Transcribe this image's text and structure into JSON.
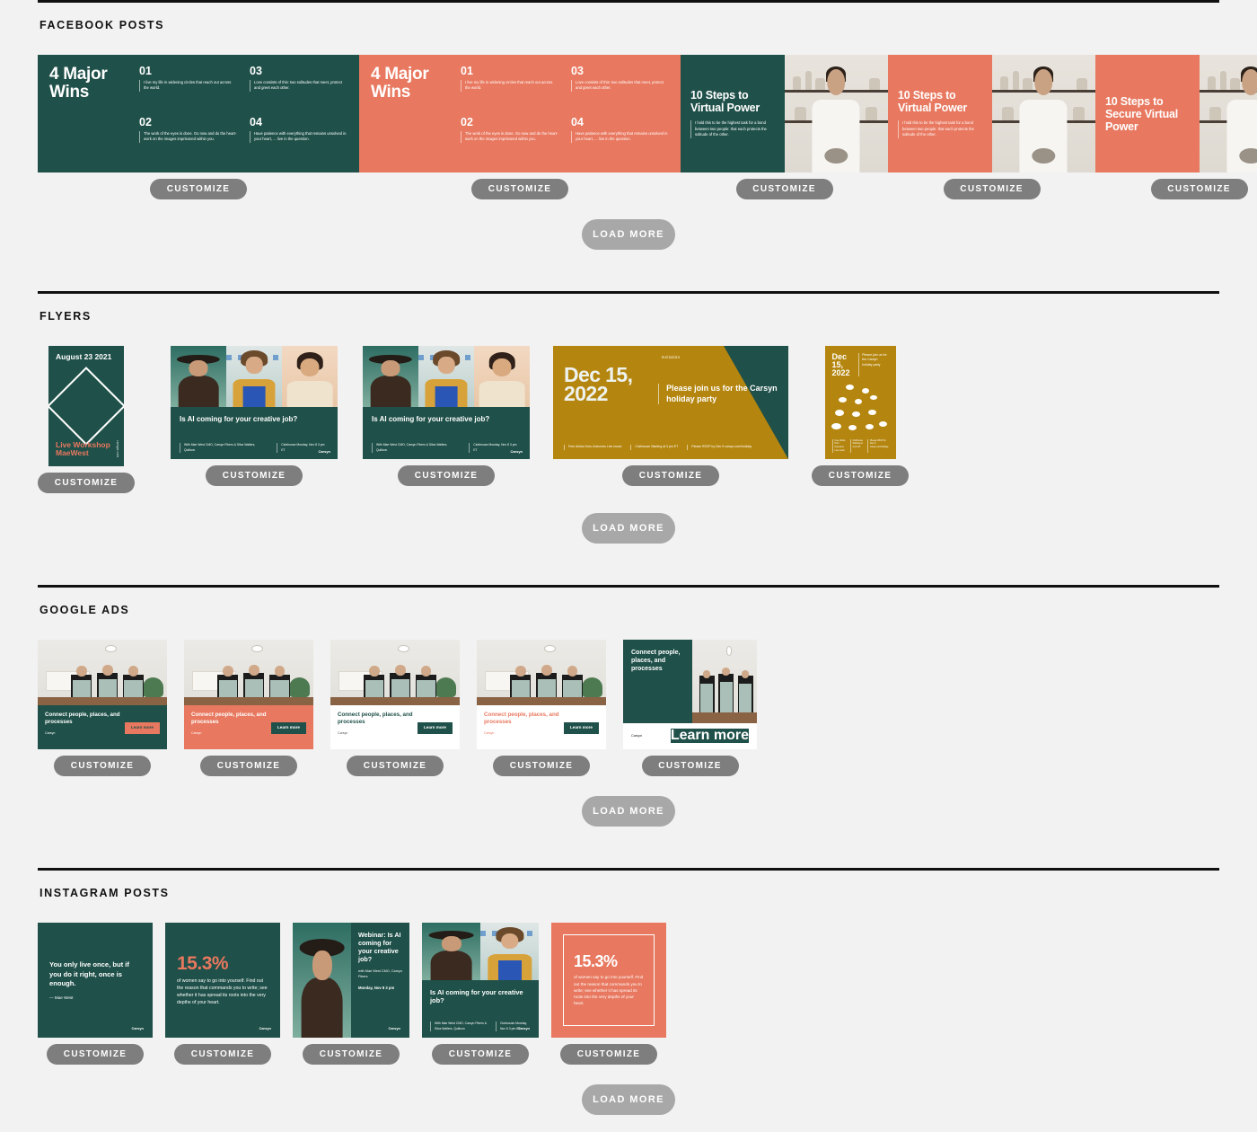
{
  "buttons": {
    "customize": "CUSTOMIZE",
    "load_more": "LOAD MORE"
  },
  "brand": "Carsyn",
  "colors": {
    "green": "#1f5049",
    "coral": "#e8785f",
    "yellow": "#b5860f",
    "customize_gray": "#7e7e7e",
    "loadmore_gray": "#a8a8a8"
  },
  "sections": {
    "facebook": {
      "title": "FACEBOOK POSTS"
    },
    "flyers": {
      "title": "FLYERS"
    },
    "google": {
      "title": "GOOGLE ADS"
    },
    "instagram": {
      "title": "INSTAGRAM POSTS"
    }
  },
  "wins": {
    "title": "4 Major Wins",
    "items": [
      {
        "num": "01",
        "body": "I live my life in widening circles that reach out across the world."
      },
      {
        "num": "02",
        "body": "The work of the eyes is done. Go now and do the heart-work on the images imprisoned within you."
      },
      {
        "num": "03",
        "body": "Love consists of this: two solitudes that meet, protect and greet each other."
      },
      {
        "num": "04",
        "body": "Have patience with everything that remains unsolved in your heart, ... live in the question."
      }
    ]
  },
  "steps": {
    "title": "10 Steps to Virtual Power",
    "title_secure": "10 Steps to Secure Virtual Power",
    "body": "I hold this to be the highest task for a bond between two people: that each protects the solitude of the other."
  },
  "flyer_aug": {
    "date": "August 23 2021",
    "event": "Live Workshop MaeWest",
    "url": "carsyn.com"
  },
  "flyer_ai": {
    "headline": "Is AI coming for your creative job?",
    "meta_left": "With Mae West CMO, Carsyn Fibers & Silva Wallers, Quillcon",
    "meta_right": "Clubhouse Monday, Nov 8 3 pm ET"
  },
  "flyer_dec": {
    "label": "Invitation",
    "date": "Dec 15, 2022",
    "headline": "Please join us for the Carsyn holiday party",
    "feet": [
      "Free drinks Hors d'oeuvres Live music",
      "Clubhouse Starting at 3 pm ET",
      "Please RSVP by Dec 9 carsyn.com/holiday"
    ]
  },
  "ad": {
    "headline": "Connect people, places, and processes",
    "cta": "Learn more",
    "brand": "Carsyn"
  },
  "ig_quote": {
    "text": "You only live once, but if you do it right, once is enough.",
    "attribution": "— Mae West"
  },
  "ig_stat": {
    "pct": "15.3%",
    "body": "of women say to go into yourself. Find out the reason that commands you to write; see whether it has spread its roots into the very depths of your heart."
  },
  "ig_webinar": {
    "headline": "Webinar: Is AI coming for your creative job?",
    "sub": "with Mae West CMO, Carsyn Fibers",
    "when": "Monday, Nov 8 3 pm"
  },
  "ig_ai": {
    "headline": "Is AI coming for your creative job?",
    "meta_left": "With Mae West CMO, Carsyn Fibers & Silva Wallers, Quillcon",
    "meta_right": "Clubhouse Monday, Nov 8 3 pm ET"
  }
}
